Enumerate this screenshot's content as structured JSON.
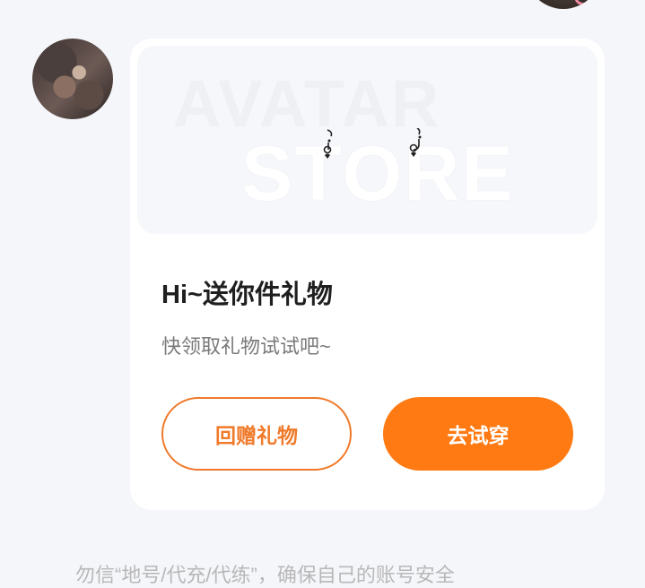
{
  "banner": {
    "watermark_line1": "AVATAR",
    "watermark_line2": "STORE"
  },
  "card": {
    "title": "Hi~送你件礼物",
    "subtitle": "快领取礼物试试吧~",
    "gift_back_label": "回赠礼物",
    "try_on_label": "去试穿"
  },
  "footer": {
    "notice": "勿信“地号/代充/代练”，确保自己的账号安全"
  },
  "colors": {
    "accent": "#ff7a12",
    "outline": "#f07a2a",
    "page_bg": "#f5f6fa"
  }
}
